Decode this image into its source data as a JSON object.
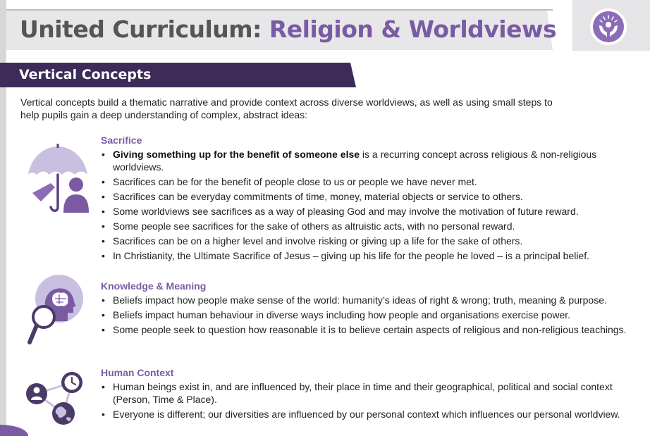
{
  "header": {
    "title_part1": "United Curriculum: ",
    "title_part2": "Religion & Worldviews"
  },
  "section": {
    "title": "Vertical Concepts"
  },
  "intro": "Vertical concepts build a thematic narrative and provide context across diverse worldviews, as well as using small steps to help pupils gain a deep understanding of complex, abstract ideas:",
  "concepts": [
    {
      "heading": "Sacrifice",
      "icon": "umbrella-person-icon",
      "bullets": [
        {
          "bold": "Giving something up for the benefit of someone else",
          "text": " is a recurring concept across religious & non-religious worldviews."
        },
        {
          "bold": "",
          "text": "Sacrifices can be for the benefit of people close to us or people we have never met."
        },
        {
          "bold": "",
          "text": "Sacrifices can be everyday commitments of time, money, material objects or service to others."
        },
        {
          "bold": "",
          "text": "Some worldviews see sacrifices as a way of pleasing God and may involve the motivation of future reward."
        },
        {
          "bold": "",
          "text": "Some people see sacrifices for the sake of others as altruistic acts, with no personal reward."
        },
        {
          "bold": "",
          "text": "Sacrifices can be on a higher level and involve risking or giving up a life for the sake of others."
        },
        {
          "bold": "",
          "text": "In Christianity, the Ultimate Sacrifice of Jesus – giving up his life for the people he loved – is a principal belief."
        }
      ]
    },
    {
      "heading": "Knowledge & Meaning",
      "icon": "head-magnifier-icon",
      "bullets": [
        {
          "bold": "",
          "text": "Beliefs impact how people make sense of the world: humanity’s ideas of right & wrong; truth, meaning & purpose."
        },
        {
          "bold": "",
          "text": "Beliefs impact human behaviour in diverse ways including how people and organisations exercise power."
        },
        {
          "bold": "",
          "text": "Some people seek to question how reasonable it is to believe certain aspects of religious and non-religious teachings."
        }
      ]
    },
    {
      "heading": "Human Context",
      "icon": "person-time-place-icon",
      "bullets": [
        {
          "bold": "",
          "text": "Human beings exist in, and are influenced by, their place in time and their geographical, political and social context (Person, Time & Place)."
        },
        {
          "bold": "",
          "text": "Everyone is different; our diversities are influenced by our personal context which influences our personal worldview."
        }
      ]
    }
  ],
  "colors": {
    "accent_purple": "#7a5ba3",
    "dark_purple": "#3e2b57",
    "light_purple": "#c9bfe0",
    "title_grey": "#555555"
  },
  "logo": {
    "icon": "hands-sun-icon"
  }
}
